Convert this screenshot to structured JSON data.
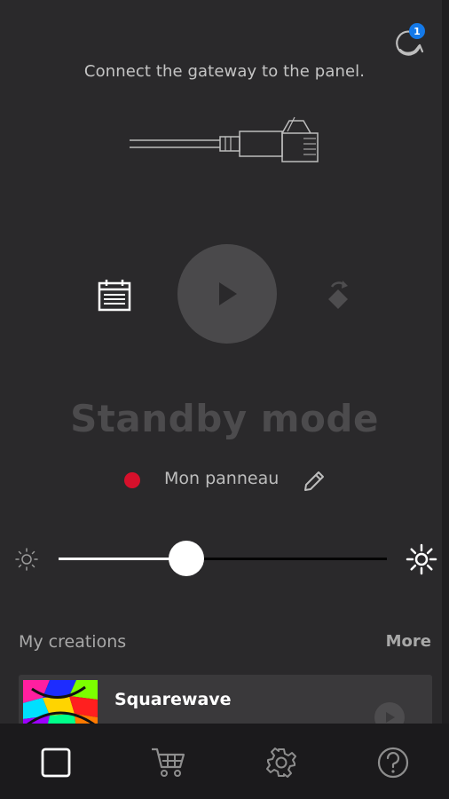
{
  "header": {
    "sync_badge": "1"
  },
  "connect": {
    "instruction": "Connect the gateway to the panel."
  },
  "controls": {
    "schedule_icon": "calendar-icon",
    "play_icon": "play-icon",
    "random_icon": "shuffle-icon"
  },
  "status": {
    "mode": "Standby mode",
    "panel_name": "Mon panneau",
    "dot_color": "#d6102b"
  },
  "brightness": {
    "value_percent": 39
  },
  "creations": {
    "title": "My creations",
    "more_label": "More",
    "items": [
      {
        "name": "Squarewave"
      }
    ]
  },
  "nav": {
    "items": [
      "panel-icon",
      "cart-icon",
      "gear-icon",
      "help-icon"
    ]
  },
  "colors": {
    "background": "#2a292b",
    "nav_background": "#1b1a1c",
    "badge": "#1479e8",
    "offline_dot": "#d6102b"
  }
}
